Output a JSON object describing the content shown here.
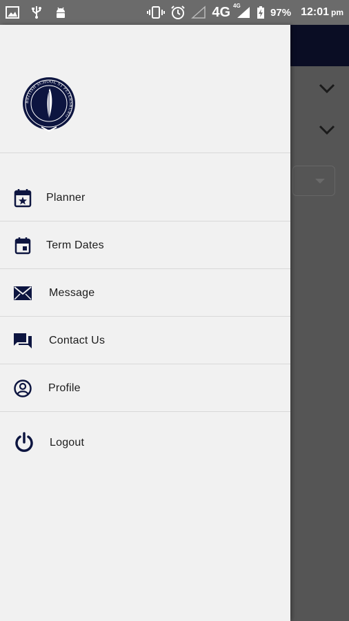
{
  "status_bar": {
    "battery": "97%",
    "time": "12:01",
    "ampm": "pm",
    "network": "4G",
    "network_small": "4G"
  },
  "drawer": {
    "logo": {
      "name": "school-crest-logo",
      "text": "BRITISH SCHOOL ST PETERSBURG"
    },
    "menu": [
      {
        "label": "Planner",
        "icon": "calendar-star-icon"
      },
      {
        "label": "Term Dates",
        "icon": "calendar-icon"
      },
      {
        "label": "Message",
        "icon": "envelope-icon"
      },
      {
        "label": "Contact Us",
        "icon": "chat-icon"
      },
      {
        "label": "Profile",
        "icon": "user-circle-icon"
      },
      {
        "label": "Logout",
        "icon": "power-icon"
      }
    ]
  },
  "colors": {
    "navy": "#0d1540",
    "drawer_bg": "#f1f1f1",
    "scrim": "#555555"
  }
}
